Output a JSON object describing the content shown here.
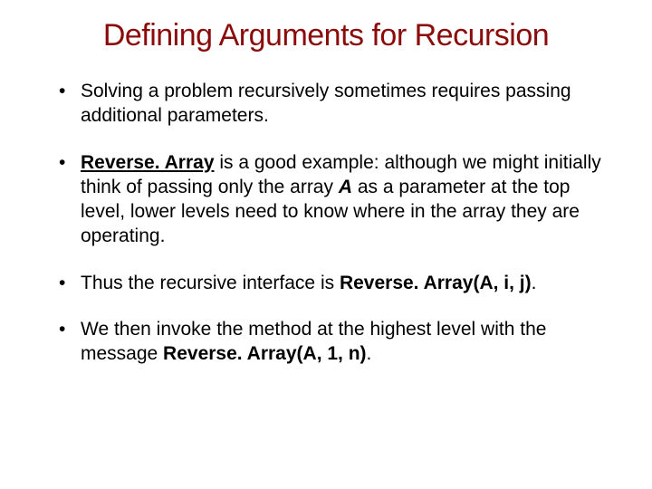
{
  "title": "Defining Arguments for Recursion",
  "bullets": {
    "b1": "Solving a problem recursively sometimes requires passing additional parameters.",
    "b2_pre": "Reverse. Array",
    "b2_mid": " is a good example:  although we might initially think of passing only the array ",
    "b2_A": "A",
    "b2_post": " as a parameter at the top level, lower levels need to know where in the array they are operating.",
    "b3_pre": "Thus the recursive interface is ",
    "b3_call": "Reverse. Array(A, i, j)",
    "b3_post": ".",
    "b4_pre": "We then invoke the method at the highest level with the message ",
    "b4_call": "Reverse. Array(A, 1, n)",
    "b4_post": "."
  }
}
